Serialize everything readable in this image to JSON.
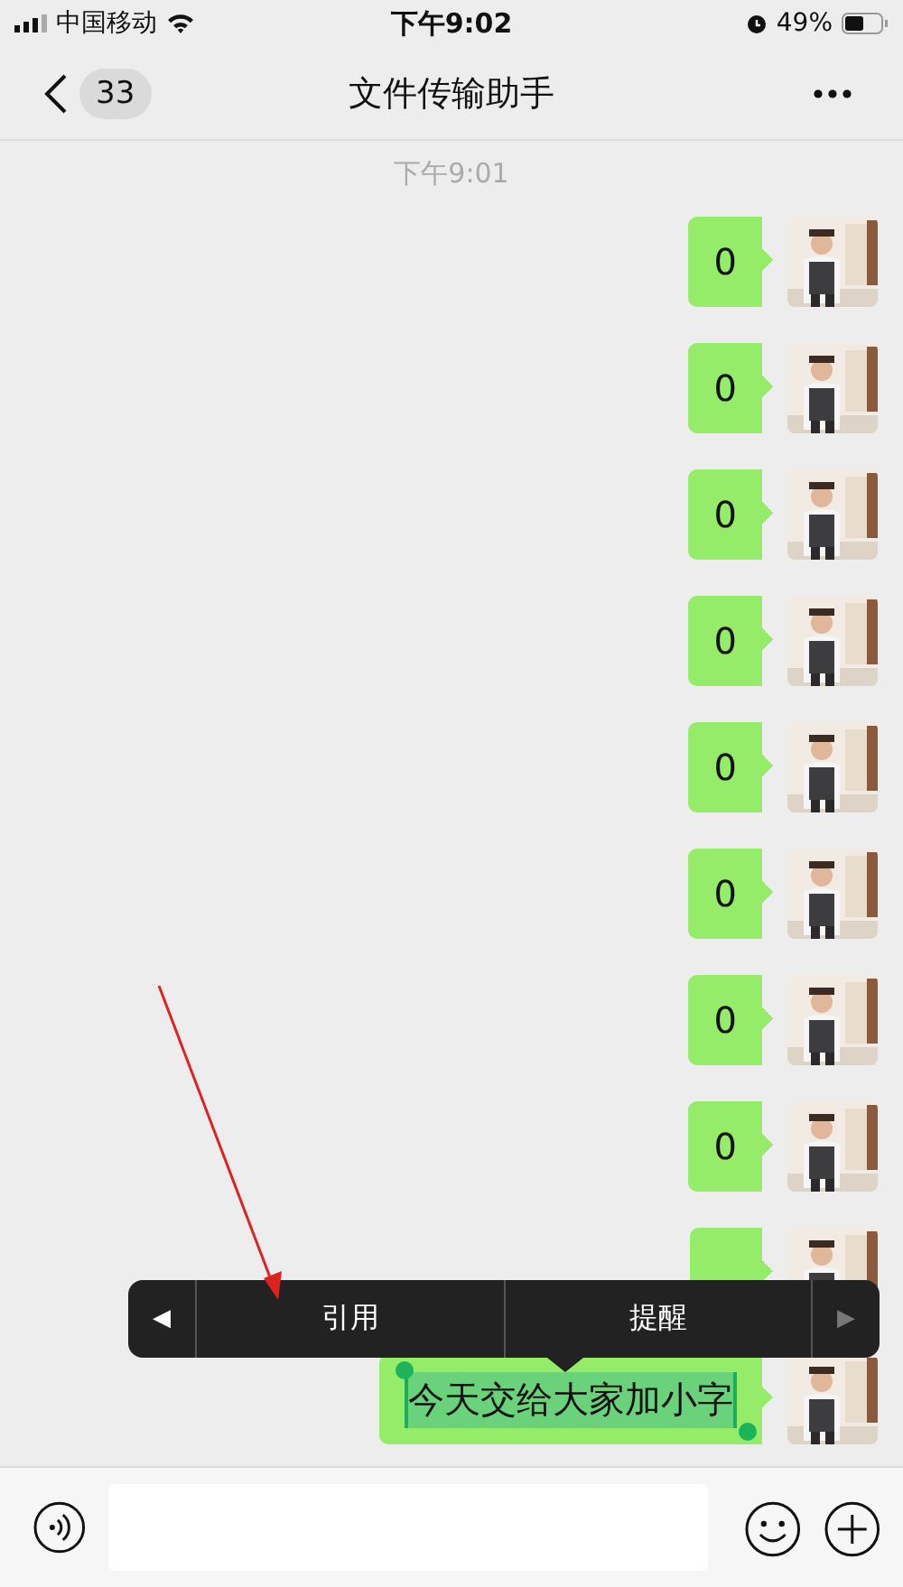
{
  "status_bar": {
    "carrier": "中国移动",
    "time": "下午9:02",
    "battery": "49%"
  },
  "nav": {
    "unread_count": "33",
    "title": "文件传输助手"
  },
  "timestamp": "下午9:01",
  "messages": [
    {
      "kind": "text",
      "text": "0",
      "selected": false
    },
    {
      "kind": "text",
      "text": "0",
      "selected": false
    },
    {
      "kind": "text",
      "text": "0",
      "selected": false
    },
    {
      "kind": "text",
      "text": "0",
      "selected": false
    },
    {
      "kind": "text",
      "text": "0",
      "selected": false
    },
    {
      "kind": "text",
      "text": "0",
      "selected": false
    },
    {
      "kind": "text",
      "text": "0",
      "selected": false
    },
    {
      "kind": "text",
      "text": "0",
      "selected": false
    },
    {
      "kind": "text",
      "selected": false
    },
    {
      "kind": "text",
      "text": "今天交给大家加小字",
      "selected": true
    }
  ],
  "context_menu": {
    "prev": {
      "label": "◀",
      "disabled": false
    },
    "items": [
      "引用",
      "提醒"
    ],
    "next": {
      "label": "▶",
      "disabled": true
    }
  }
}
